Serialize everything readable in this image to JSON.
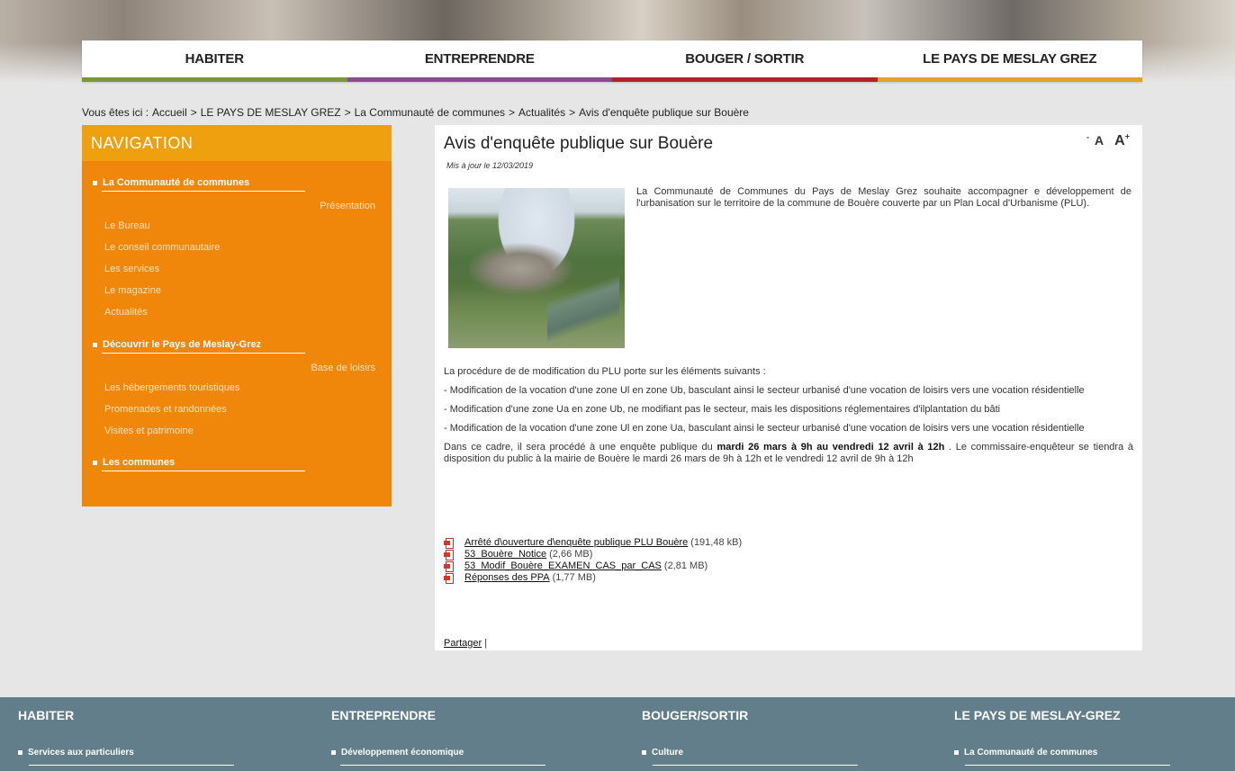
{
  "colors": {
    "nav_habiter": "#7a9a3a",
    "nav_entreprendre": "#8a4b8f",
    "nav_bouger": "#b3232e",
    "nav_pays": "#e6a12a",
    "sidebar": "#f0860a",
    "sidebar_title": "#eea00f",
    "footer": "#617e8a"
  },
  "mainnav": [
    {
      "label": "HABITER"
    },
    {
      "label": "ENTREPRENDRE"
    },
    {
      "label": "BOUGER / SORTIR"
    },
    {
      "label": "LE PAYS DE MESLAY GREZ"
    }
  ],
  "breadcrumb": {
    "prefix": "Vous êtes ici :",
    "items": [
      "Accueil",
      ">",
      "LE PAYS DE MESLAY GREZ",
      ">",
      "La Communauté de communes",
      ">",
      "Actualités",
      ">",
      "Avis d'enquête publique sur Bouère"
    ]
  },
  "sidebar": {
    "title": "NAVIGATION",
    "section1": "La Communauté de communes",
    "section1_sub": "Présentation",
    "section1_links": [
      "Le Bureau",
      "Le conseil communautaire",
      "Les services",
      "Le magazine",
      "Actualités"
    ],
    "section2": "Découvrir le Pays de Meslay-Grez",
    "section2_sub": "Base de loisirs",
    "section2_links": [
      "Les hébergements touristiques",
      "Promenades et randonnées",
      "Visites et patrimoine"
    ],
    "section3": "Les communes"
  },
  "article": {
    "title": "Avis d'enquête publique sur Bouère",
    "updated": "Mis à jour le 12/03/2019",
    "font_small": "A",
    "font_large": "A",
    "intro": "La Communauté de Communes du Pays de Meslay Grez souhaite accompagner e développement de l'urbanisation sur le territoire de la commune de Bouère couverte par un Plan Local d'Urbanisme (PLU).",
    "p1": "La procédure de de modification du PLU porte sur les éléments suivants :",
    "p2": "- Modification de la vocation d'une zone Ul en zone Ub, basculant ainsi le secteur urbanisé d'une vocation de loisirs vers une vocation résidentielle",
    "p3": "- Modification d'une zone Ua en zone Ub, ne modifiant pas le secteur, mais les dispositions réglementaires d'ilplantation du bâti",
    "p4": "- Modification de la vocation d'une zone Ul en zone Ua, basculant ainsi le secteur urbanisé d'une vocation de loisirs vers une vocation résidentielle",
    "p5_a": "Dans ce cadre, il sera procédé à une enquête publique du ",
    "p5_b": "mardi 26 mars à 9h au vendredi 12 avril à 12h",
    "p5_c": " . Le commissaire-enquêteur se tiendra à disposition du public à la mairie de Bouère le mardi 26 mars de 9h à 12h et le vendredi 12 avril de 9h à 12h",
    "files": [
      {
        "name": "Arrêté d\\ouverture d\\enquête publique PLU Bouère",
        "size": "(191,48 kB)"
      },
      {
        "name": "53_Bouère_Notice",
        "size": "(2,66 MB)"
      },
      {
        "name": "53_Modif_Bouère_EXAMEN_CAS_par_CAS",
        "size": "(2,81 MB)"
      },
      {
        "name": "Réponses des PPA",
        "size": "(1,77 MB)"
      }
    ],
    "share": "Partager",
    "share_sep": "|"
  },
  "footer": {
    "cols": [
      {
        "title": "HABITER",
        "link": "Services aux particuliers"
      },
      {
        "title": "ENTREPRENDRE",
        "link": "Développement économique"
      },
      {
        "title": "BOUGER/SORTIR",
        "link": "Culture"
      },
      {
        "title": "LE PAYS DE MESLAY-GREZ",
        "link": "La Communauté de communes"
      }
    ]
  }
}
